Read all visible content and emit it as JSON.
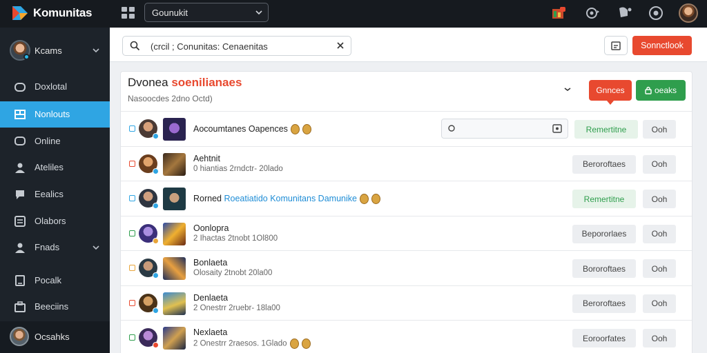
{
  "app": {
    "brand": "Komunitas"
  },
  "topbar": {
    "select_value": "Gounukit",
    "icons": [
      "grid-icon",
      "calendar-badge-icon",
      "settings-icon",
      "notifications-icon",
      "sync-icon"
    ]
  },
  "sidebar": {
    "user_name": "Kcams",
    "items": [
      {
        "label": "Doxlotal",
        "icon": "home-icon"
      },
      {
        "label": "Nonlouts",
        "icon": "layout-icon",
        "active": true
      },
      {
        "label": "Online",
        "icon": "chat-icon"
      },
      {
        "label": "Ateliles",
        "icon": "user-icon"
      },
      {
        "label": "Eealics",
        "icon": "bubble-icon"
      },
      {
        "label": "Olabors",
        "icon": "list-icon"
      },
      {
        "label": "Fnads",
        "icon": "person-icon"
      },
      {
        "label": "Pocalk",
        "icon": "doc-icon"
      },
      {
        "label": "Beeciins",
        "icon": "briefcase-icon"
      }
    ],
    "bottom_user": "Ocsahks"
  },
  "header": {
    "search_value": "(crcil ; Conunitas: Cenaenitas",
    "primary_button": "Sonnctlook"
  },
  "panel": {
    "title_plain": "Dvonea",
    "title_accent": "soenilianaes",
    "subtitle": "Nasoocdes 2dno Octd)",
    "red_button": "Gnnces",
    "green_button": "oeaks",
    "rows": [
      {
        "title": "Aocoumtanes Oapences",
        "meta": "",
        "link": "",
        "emoji_count": 2,
        "input": true,
        "action": "Remertitne",
        "action_green": true,
        "secondary": "Ooh",
        "check_color": "#2fa5e3"
      },
      {
        "title": "Aehtnit",
        "meta": "0 hiantias 2rndctr- 20lado",
        "link": "",
        "emoji_count": 0,
        "input": false,
        "action": "Beroroftaes",
        "action_green": false,
        "secondary": "Ooh",
        "check_color": "#e8492f"
      },
      {
        "title": "Rorned",
        "meta": "",
        "link": "Roeatiatido Komunitans Damunike",
        "emoji_count": 2,
        "input": false,
        "action": "Remertitne",
        "action_green": true,
        "secondary": "Ooh",
        "check_color": "#2fa5e3"
      },
      {
        "title": "Oonlopra",
        "meta": "2 Ihactas 2tnobt 1Ol800",
        "link": "",
        "emoji_count": 0,
        "input": false,
        "action": "Bepororlaes",
        "action_green": false,
        "secondary": "Ooh",
        "check_color": "#2f9e4d"
      },
      {
        "title": "Bonlaeta",
        "meta": "Olosaity 2tnobt 20la00",
        "link": "",
        "emoji_count": 0,
        "input": false,
        "action": "Bororoftaes",
        "action_green": false,
        "secondary": "Ooh",
        "check_color": "#e8a53a"
      },
      {
        "title": "Denlaeta",
        "meta": "2 Onestrr 2ruebr- 18la00",
        "link": "",
        "emoji_count": 0,
        "input": false,
        "action": "Beroroftaes",
        "action_green": false,
        "secondary": "Ooh",
        "check_color": "#e8492f"
      },
      {
        "title": "Nexlaeta",
        "meta": "2 Onestrr 2raesos. 1Glado",
        "link": "",
        "emoji_count": 2,
        "input": false,
        "action": "Eoroorfates",
        "action_green": false,
        "secondary": "Ooh",
        "check_color": "#2f9e4d"
      }
    ]
  },
  "colors": {
    "accent": "#e8492f",
    "active_nav": "#2fa5e3",
    "success": "#2f9e4d",
    "sidebar_bg": "#1d232a",
    "topbar_bg": "#161a1f"
  }
}
